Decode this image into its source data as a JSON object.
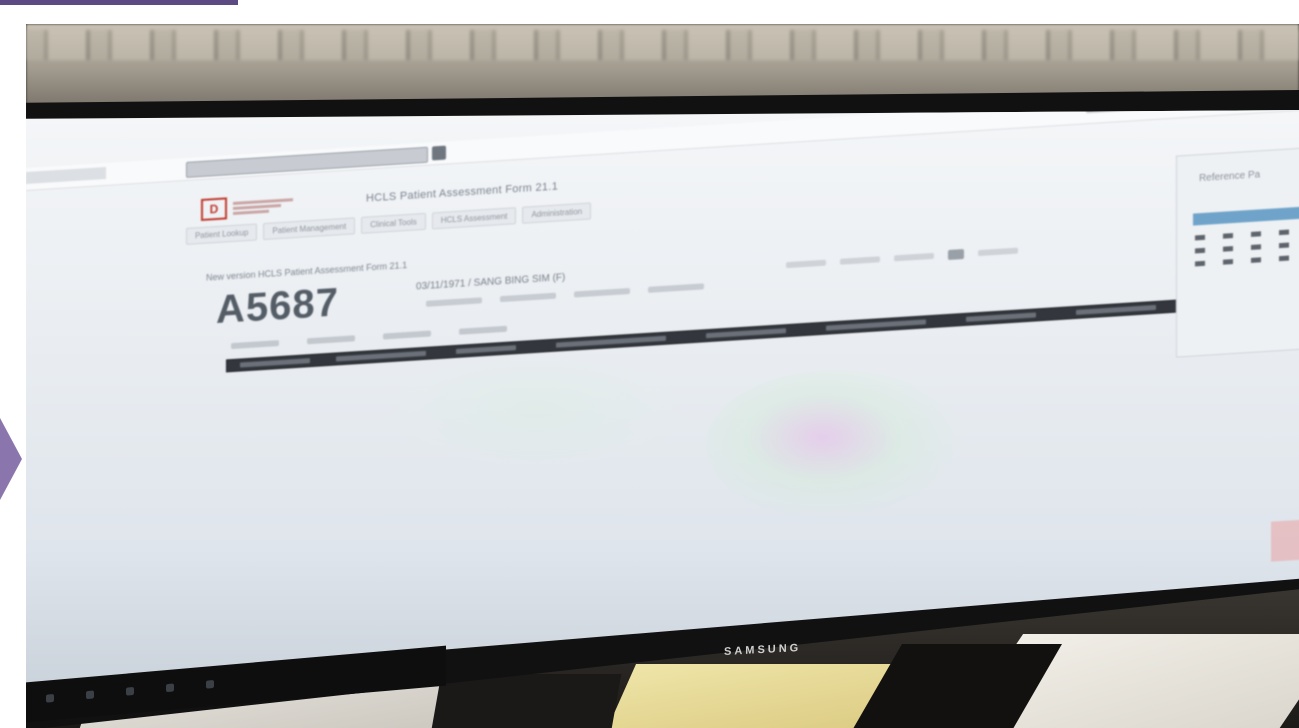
{
  "header": {
    "logo_mark": "D",
    "app_title": "HCLS Patient Assessment Form 21.1",
    "search_placeholder": ""
  },
  "tabs": [
    {
      "label": "Patient Lookup"
    },
    {
      "label": "Patient Management"
    },
    {
      "label": "Clinical Tools"
    },
    {
      "label": "HCLS Assessment"
    },
    {
      "label": "Administration"
    }
  ],
  "page": {
    "heading": "New version HCLS Patient Assessment Form 21.1",
    "patient_id": "A5687",
    "patient_meta": "03/11/1971 / SANG BING SIM (F)"
  },
  "side_panel": {
    "title": "Reference Pa"
  },
  "monitor": {
    "brand": "SAMSUNG"
  },
  "colors": {
    "slide_accent": "#5e4a82",
    "slide_arrow": "#8a76ad",
    "logo_red": "#c0392b",
    "calendar_header": "#6fa3c9",
    "dark_bar": "#33373d"
  }
}
